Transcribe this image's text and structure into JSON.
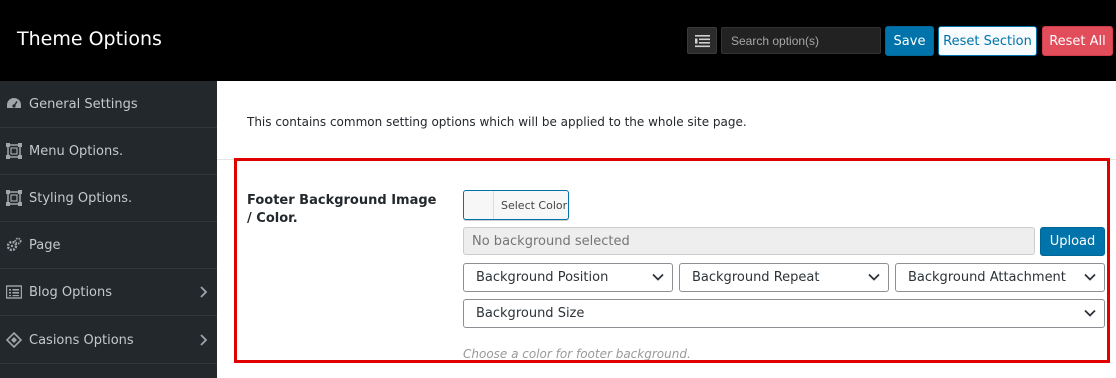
{
  "header": {
    "title": "Theme Options",
    "search_placeholder": "Search option(s)",
    "save_label": "Save",
    "reset_section_label": "Reset Section",
    "reset_all_label": "Reset All",
    "menu_icon": "list-toggle-icon"
  },
  "sidebar": {
    "items": [
      {
        "label": "General Settings",
        "icon": "dashboard-icon"
      },
      {
        "label": "Menu Options.",
        "icon": "screenoptions-icon"
      },
      {
        "label": "Styling Options.",
        "icon": "screenoptions-icon"
      },
      {
        "label": "Page",
        "icon": "gears-icon"
      },
      {
        "label": "Blog Options",
        "icon": "list-icon",
        "has_submenu": true
      },
      {
        "label": "Casions Options",
        "icon": "diamond-icon",
        "has_submenu": true
      }
    ]
  },
  "main": {
    "description": "This contains common setting options which will be applied to the whole site page.",
    "field": {
      "label": "Footer Background Image / Color.",
      "select_color_label": "Select Color",
      "background_placeholder": "No background selected",
      "upload_label": "Upload",
      "position_label": "Background Position",
      "repeat_label": "Background Repeat",
      "attachment_label": "Background Attachment",
      "size_label": "Background Size",
      "hint": "Choose a color for footer background."
    }
  },
  "colors": {
    "header_bg": "#000000",
    "sidebar_bg": "#23282d",
    "primary": "#0073aa",
    "danger": "#e14d5a",
    "highlight": "#e00000"
  }
}
